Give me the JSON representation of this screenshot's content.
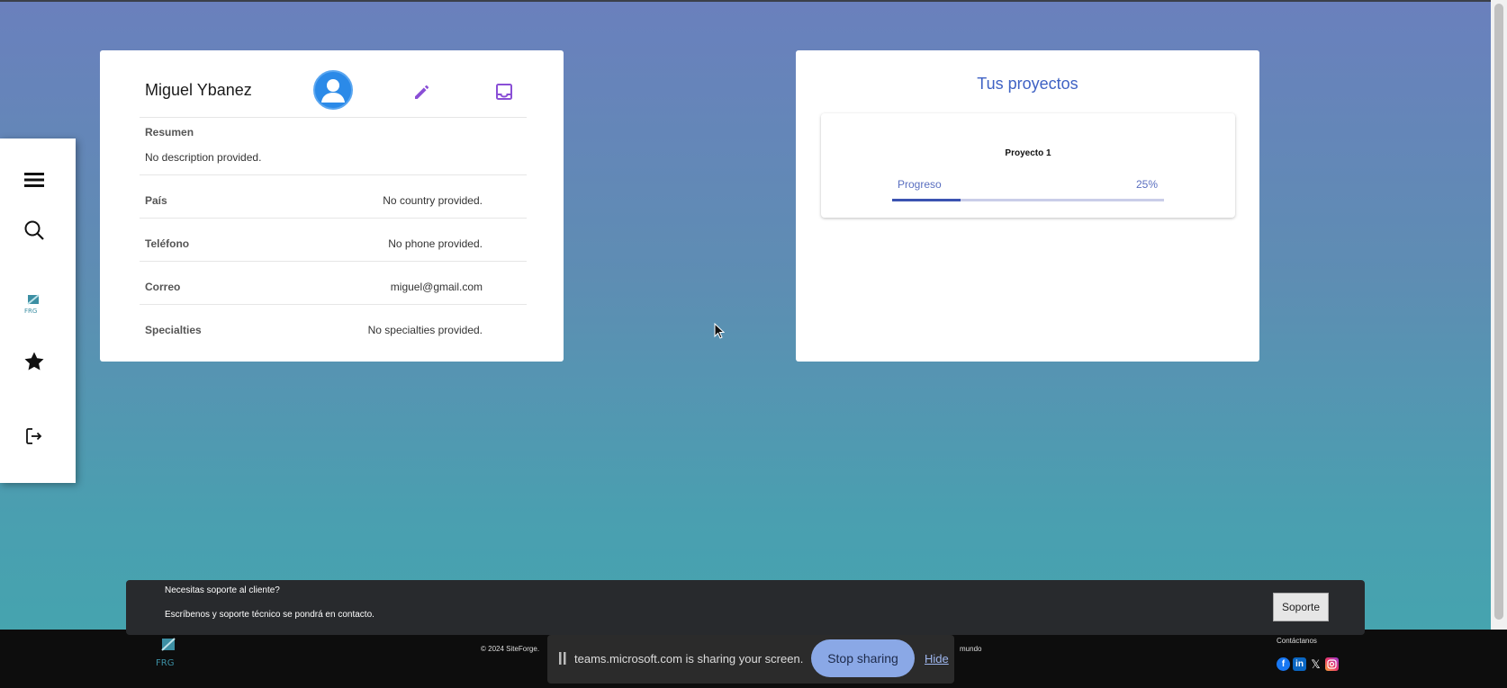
{
  "sidebar": {
    "items": [
      {
        "icon": "menu-icon"
      },
      {
        "icon": "search-icon"
      },
      {
        "icon": "logo-icon"
      },
      {
        "icon": "star-icon"
      },
      {
        "icon": "logout-icon"
      }
    ]
  },
  "profile": {
    "name": "Miguel Ybanez",
    "summary_label": "Resumen",
    "summary_value": "No description provided.",
    "rows": [
      {
        "label": "País",
        "value": "No country provided."
      },
      {
        "label": "Teléfono",
        "value": "No phone provided."
      },
      {
        "label": "Correo",
        "value": "miguel@gmail.com"
      },
      {
        "label": "Specialties",
        "value": "No specialties provided."
      }
    ]
  },
  "projects": {
    "title": "Tus proyectos",
    "items": [
      {
        "name": "Proyecto 1",
        "progress_label": "Progreso",
        "progress_text": "25%",
        "progress": 0.25
      }
    ]
  },
  "support": {
    "question": "Necesitas soporte al cliente?",
    "description": "Escríbenos y soporte técnico se pondrá en contacto.",
    "button": "Soporte"
  },
  "footer": {
    "copyright": "© 2024 SiteForge.",
    "tagline_end": "mundo",
    "contact": "Contáctanos"
  },
  "share_bar": {
    "message": "teams.microsoft.com is sharing your screen.",
    "stop_button": "Stop sharing",
    "hide_link": "Hide"
  },
  "colors": {
    "accent": "#3f62c4",
    "progress_fill": "#3b53b1",
    "icon_purple": "#8a4fd6",
    "avatar_blue": "#2b8ae8"
  }
}
